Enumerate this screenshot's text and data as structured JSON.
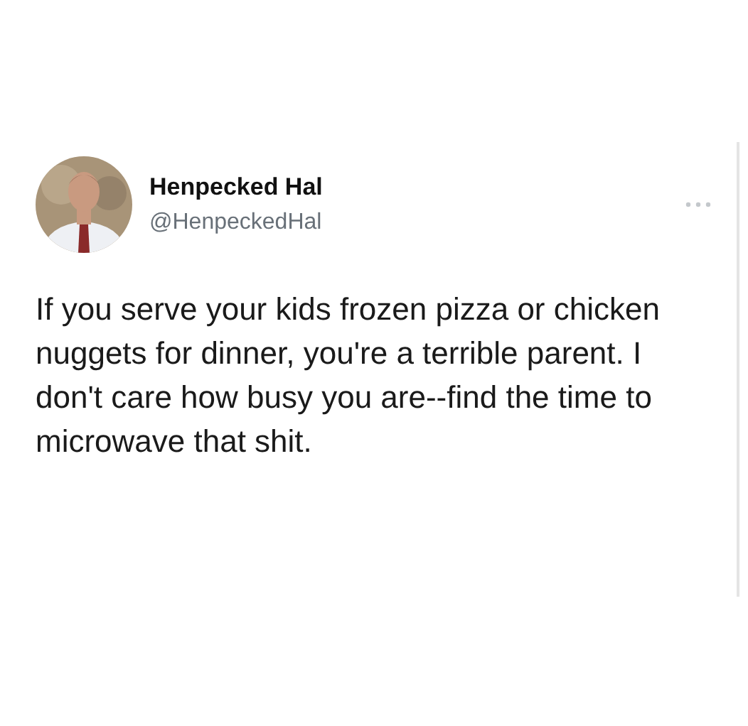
{
  "tweet": {
    "author": {
      "name": "Henpecked Hal",
      "handle": "@HenpeckedHal"
    },
    "text": "If you serve your kids frozen pizza or chicken nuggets for dinner, you're a terrible parent. I don't care how busy you are--find the time to microwave that shit."
  }
}
